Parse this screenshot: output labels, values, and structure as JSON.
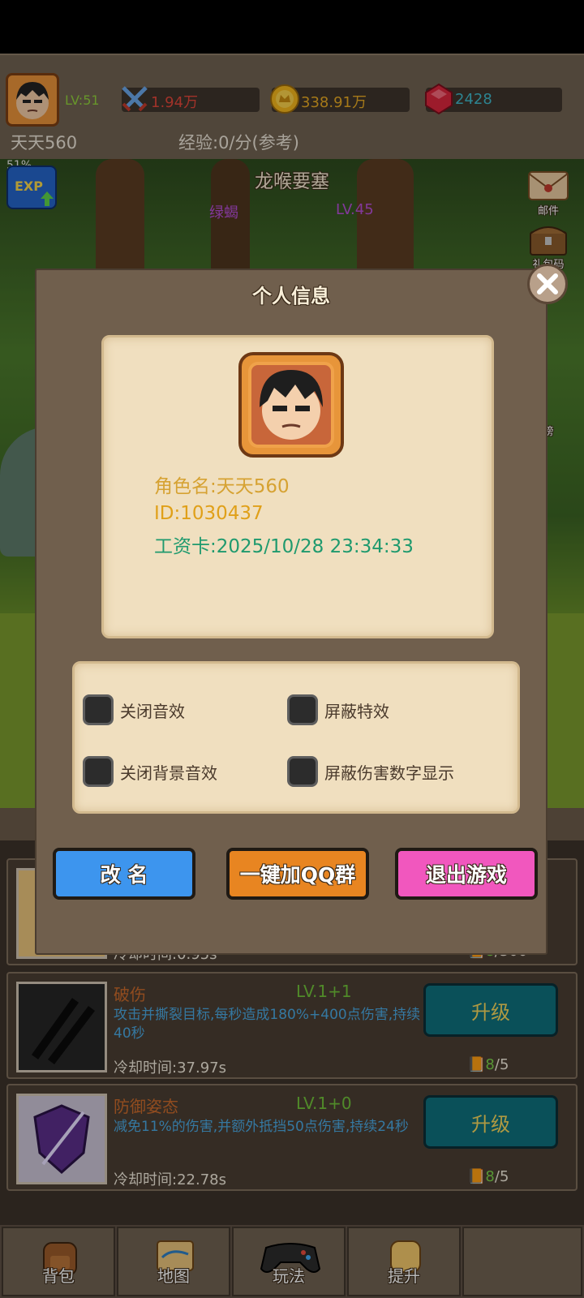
{
  "header": {
    "level": "LV:51",
    "power": "1.94万",
    "gold": "338.91万",
    "gems": "2428",
    "player_name": "天天560",
    "exp_rate": "经验:0/分(参考)"
  },
  "scene": {
    "exp_percent": "51%",
    "exp_badge": "EXP",
    "stage_name": "龙喉要塞",
    "enemy_name": "绿蝎",
    "enemy_level": "LV.45",
    "side_mail": "邮件",
    "side_gift": "礼包码",
    "side_rank": "榜"
  },
  "dialog": {
    "title": "个人信息",
    "role_name": "角色名:天天560",
    "player_id": "ID:1030437",
    "salary_card": "工资卡:2025/10/28 23:34:33",
    "settings": {
      "mute_sfx": "关闭音效",
      "hide_effects": "屏蔽特效",
      "mute_bgm": "关闭背景音效",
      "hide_damage": "屏蔽伤害数字显示"
    },
    "buttons": {
      "rename": "改 名",
      "join_qq": "一键加QQ群",
      "quit": "退出游戏"
    }
  },
  "skills": [
    {
      "name": "",
      "level": "",
      "desc": "",
      "cooldown": "冷却时间:0.95s",
      "cost_have": "8",
      "cost_need": "/500"
    },
    {
      "name": "破伤",
      "level": "LV.1+1",
      "desc": "攻击并撕裂目标,每秒造成180%+400点伤害,持续40秒",
      "cooldown": "冷却时间:37.97s",
      "cost_have": "8",
      "cost_need": "/5",
      "button": "升级"
    },
    {
      "name": "防御姿态",
      "level": "LV.1+0",
      "desc": "减免11%的伤害,并额外抵挡50点伤害,持续24秒",
      "cooldown": "冷却时间:22.78s",
      "cost_have": "8",
      "cost_need": "/5",
      "button": "升级"
    }
  ],
  "nav": {
    "bag": "背包",
    "map": "地图",
    "play": "玩法",
    "upgrade": "提升"
  }
}
